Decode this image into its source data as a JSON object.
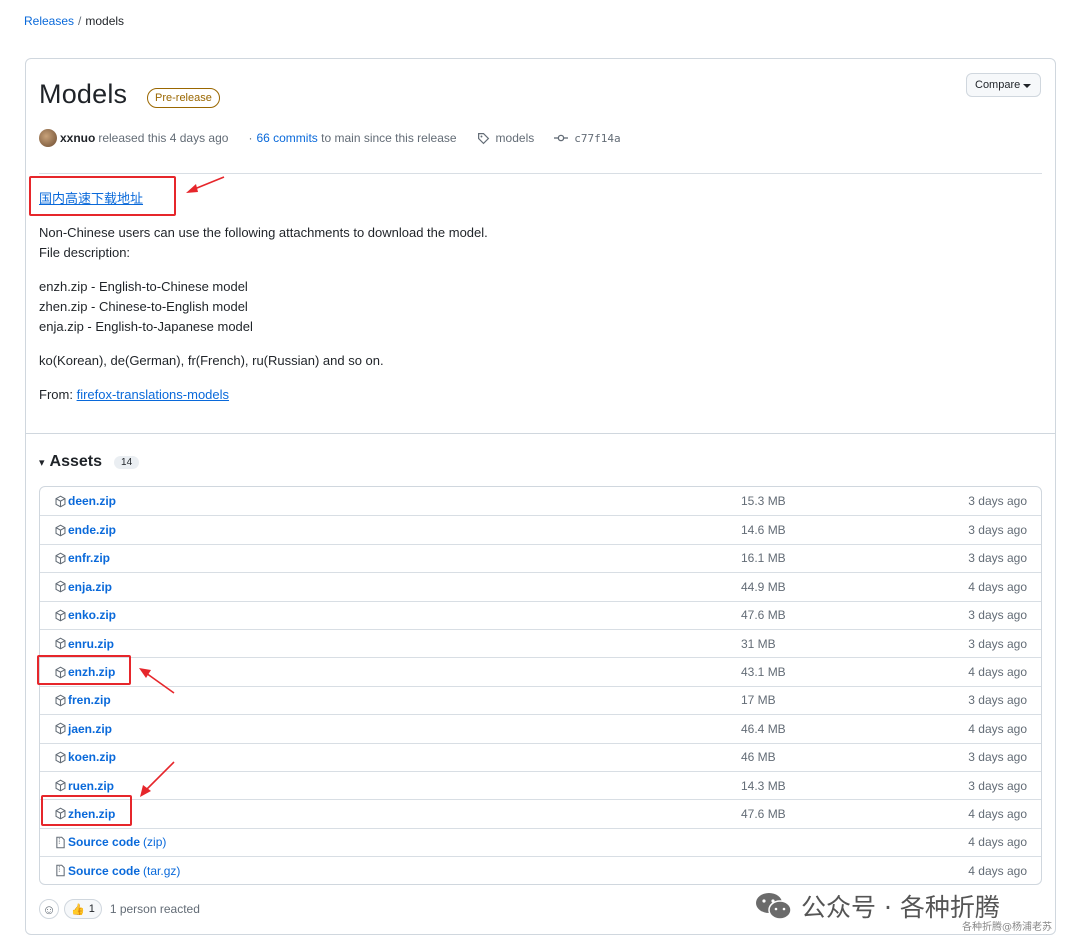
{
  "breadcrumb": {
    "parent": "Releases",
    "separator": "/",
    "current": "models"
  },
  "release": {
    "title": "Models",
    "badge": "Pre-release",
    "compare_label": "Compare",
    "author": "xxnuo",
    "released_text": "released this 4 days ago",
    "commits_dot": "·",
    "commits_link": "66 commits",
    "commits_suffix": "to main since this release",
    "tag": "models",
    "commit_hash": "c77f14a"
  },
  "description": {
    "cn_link": "国内高速下载地址",
    "intro_line1": "Non-Chinese users can use the following attachments to download the model.",
    "intro_line2": "File description:",
    "files": [
      "enzh.zip - English-to-Chinese model",
      "zhen.zip - Chinese-to-English model",
      "enja.zip - English-to-Japanese model"
    ],
    "others": "ko(Korean), de(German), fr(French), ru(Russian) and so on.",
    "from_label": "From:",
    "from_link": "firefox-translations-models"
  },
  "assets": {
    "heading": "Assets",
    "triangle": "▾",
    "count": "14",
    "items": [
      {
        "name": "deen.zip",
        "ext": "",
        "size": "15.3 MB",
        "date": "3 days ago"
      },
      {
        "name": "ende.zip",
        "ext": "",
        "size": "14.6 MB",
        "date": "3 days ago"
      },
      {
        "name": "enfr.zip",
        "ext": "",
        "size": "16.1 MB",
        "date": "3 days ago"
      },
      {
        "name": "enja.zip",
        "ext": "",
        "size": "44.9 MB",
        "date": "4 days ago"
      },
      {
        "name": "enko.zip",
        "ext": "",
        "size": "47.6 MB",
        "date": "3 days ago"
      },
      {
        "name": "enru.zip",
        "ext": "",
        "size": "31 MB",
        "date": "3 days ago"
      },
      {
        "name": "enzh.zip",
        "ext": "",
        "size": "43.1 MB",
        "date": "4 days ago"
      },
      {
        "name": "fren.zip",
        "ext": "",
        "size": "17 MB",
        "date": "3 days ago"
      },
      {
        "name": "jaen.zip",
        "ext": "",
        "size": "46.4 MB",
        "date": "4 days ago"
      },
      {
        "name": "koen.zip",
        "ext": "",
        "size": "46 MB",
        "date": "3 days ago"
      },
      {
        "name": "ruen.zip",
        "ext": "",
        "size": "14.3 MB",
        "date": "3 days ago"
      },
      {
        "name": "zhen.zip",
        "ext": "",
        "size": "47.6 MB",
        "date": "4 days ago"
      },
      {
        "name": "Source code",
        "ext": "(zip)",
        "size": "",
        "date": "4 days ago"
      },
      {
        "name": "Source code",
        "ext": "(tar.gz)",
        "size": "",
        "date": "4 days ago"
      }
    ]
  },
  "reactions": {
    "smiley": "☺",
    "thumbs": "👍",
    "thumbs_count": "1",
    "summary": "1 person reacted"
  },
  "watermark": {
    "main": "公众号 · 各种折腾",
    "sub": "各种折腾@杨浦老苏"
  },
  "colors": {
    "link": "#0969da",
    "badge": "#9a6700",
    "annotation_red": "#e6262b",
    "border": "#d0d7de"
  }
}
